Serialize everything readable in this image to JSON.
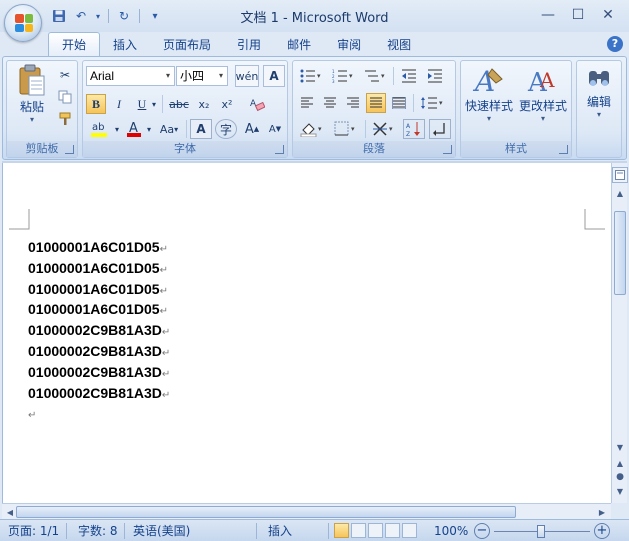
{
  "window": {
    "title": "文档 1 - Microsoft Word"
  },
  "tabs": [
    "开始",
    "插入",
    "页面布局",
    "引用",
    "邮件",
    "审阅",
    "视图"
  ],
  "ribbon": {
    "clipboard": {
      "label": "剪贴板",
      "paste": "粘贴"
    },
    "font": {
      "label": "字体",
      "font_name": "Arial",
      "font_size": "小四",
      "bold": "B",
      "italic": "I",
      "underline": "U",
      "strike": "abc",
      "subscript": "x₂",
      "superscript": "x²",
      "change_case": "Aa",
      "grow": "A",
      "shrink": "A",
      "char_border": "A",
      "enclose": "字"
    },
    "paragraph": {
      "label": "段落"
    },
    "styles": {
      "label": "样式",
      "quick_styles": "快速样式",
      "change_styles": "更改样式"
    },
    "editing": {
      "label": "编辑"
    }
  },
  "document": {
    "lines": [
      "01000001A6C01D05",
      "01000001A6C01D05",
      "01000001A6C01D05",
      "01000001A6C01D05",
      "01000002C9B81A3D",
      "01000002C9B81A3D",
      "01000002C9B81A3D",
      "01000002C9B81A3D"
    ],
    "paragraph_mark": "↵"
  },
  "status": {
    "page": "页面: 1/1",
    "words": "字数: 8",
    "language": "英语(美国)",
    "mode": "插入",
    "zoom": "100%",
    "zoom_level": 1.0
  },
  "colors": {
    "accent": "#15428b",
    "ribbon_bg": "#dbe7f6",
    "highlight": "#f6c45a"
  }
}
